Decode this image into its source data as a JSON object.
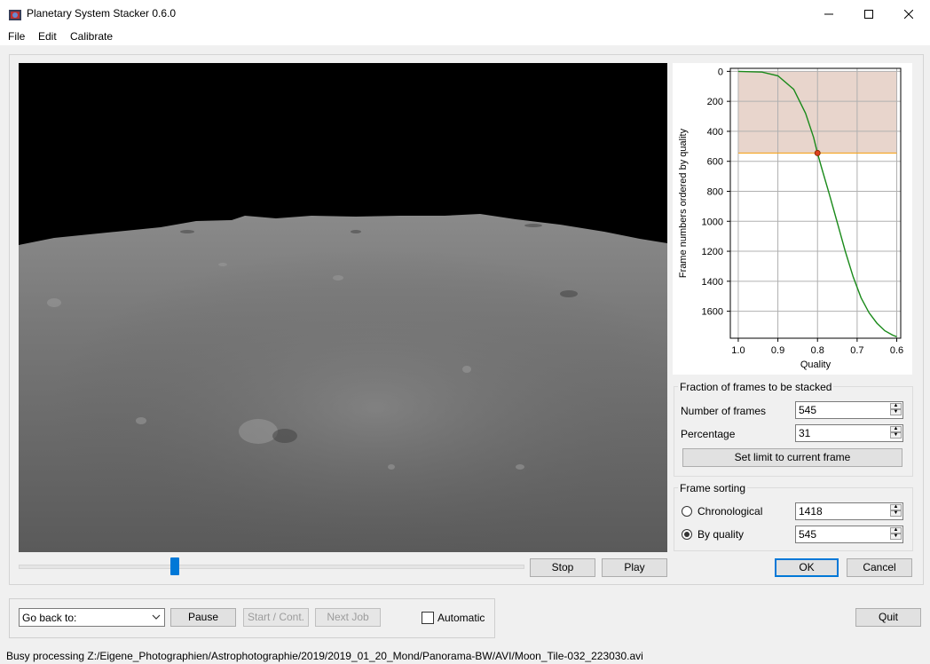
{
  "window": {
    "title": "Planetary System Stacker 0.6.0",
    "icons": [
      "app-icon",
      "minimize-icon",
      "maximize-icon",
      "close-icon"
    ]
  },
  "menu": {
    "items": [
      "File",
      "Edit",
      "Calibrate"
    ]
  },
  "player": {
    "slider_fraction": 0.31,
    "stop_label": "Stop",
    "play_label": "Play"
  },
  "chart_data": {
    "type": "line",
    "xlabel": "Quality",
    "ylabel": "Frame numbers ordered by quality",
    "xlim": [
      1.02,
      0.59
    ],
    "ylim": [
      1780,
      -20
    ],
    "x_ticks": [
      "1.0",
      "0.9",
      "0.8",
      "0.7",
      "0.6"
    ],
    "y_ticks": [
      "0",
      "200",
      "400",
      "600",
      "800",
      "1000",
      "1200",
      "1400",
      "1600"
    ],
    "grid": true,
    "series": [
      {
        "color": "#1a8a1a",
        "x": [
          1.0,
          0.94,
          0.9,
          0.86,
          0.83,
          0.81,
          0.8,
          0.79,
          0.77,
          0.75,
          0.73,
          0.71,
          0.69,
          0.67,
          0.65,
          0.63,
          0.61,
          0.6
        ],
        "y": [
          0,
          5,
          30,
          120,
          280,
          440,
          545,
          640,
          820,
          1010,
          1200,
          1370,
          1510,
          1610,
          1680,
          1730,
          1760,
          1770
        ]
      }
    ],
    "selection": {
      "quality": 0.8,
      "frame": 545,
      "line_color": "#f5a623",
      "fill_color": "#e8d5cc"
    }
  },
  "fraction_group": {
    "title": "Fraction of frames to be stacked",
    "number_label": "Number of frames",
    "number_value": "545",
    "percentage_label": "Percentage",
    "percentage_value": "31",
    "set_limit_label": "Set limit to current frame"
  },
  "sorting_group": {
    "title": "Frame sorting",
    "chronological_label": "Chronological",
    "chronological_value": "1418",
    "quality_label": "By quality",
    "quality_value": "545",
    "selected": "By quality"
  },
  "dialog": {
    "ok_label": "OK",
    "cancel_label": "Cancel"
  },
  "job": {
    "goback_value": "Go back to:",
    "pause_label": "Pause",
    "start_label": "Start / Cont.",
    "next_label": "Next Job",
    "automatic_label": "Automatic",
    "quit_label": "Quit"
  },
  "status": {
    "text": "Busy processing Z:/Eigene_Photographien/Astrophotographie/2019/2019_01_20_Mond/Panorama-BW/AVI/Moon_Tile-032_223030.avi"
  }
}
